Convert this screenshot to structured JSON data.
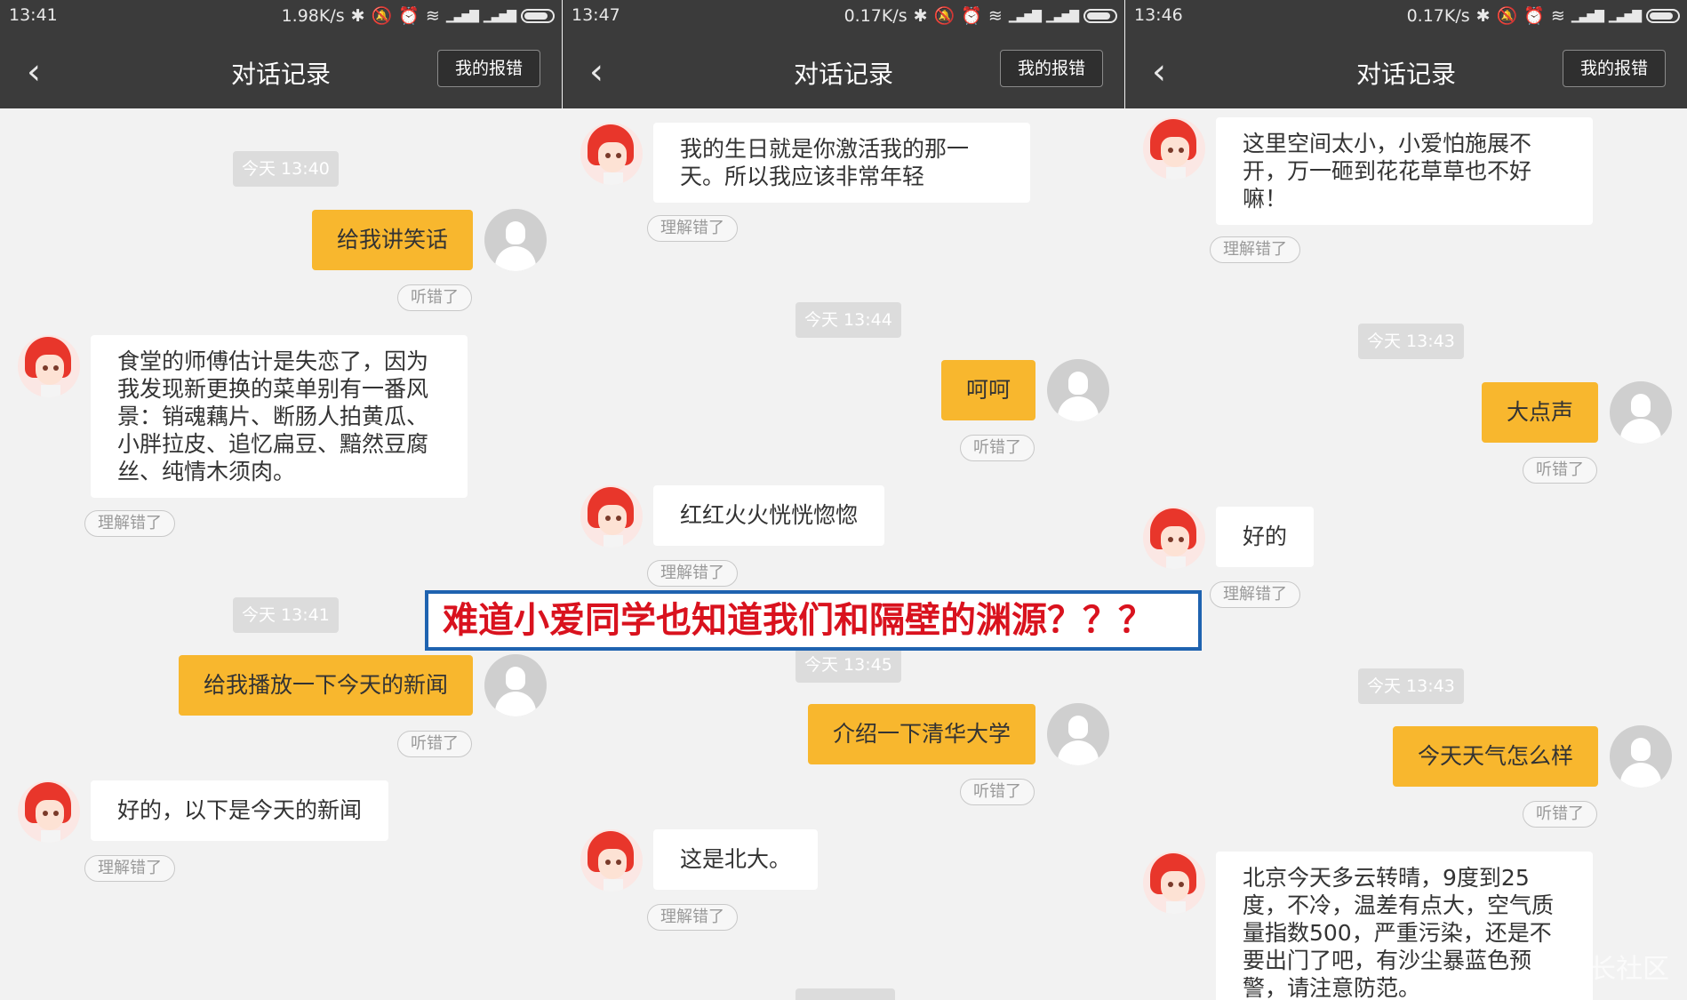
{
  "panels": [
    {
      "status": {
        "time": "13:41",
        "speed": "1.98K/s"
      },
      "header": {
        "title": "对话记录",
        "report": "我的报错"
      },
      "timestamps": [
        "今天 13:40",
        "今天 13:41"
      ],
      "user_msgs": [
        "给我讲笑话",
        "给我播放一下今天的新闻"
      ],
      "bot_msgs": [
        "食堂的师傅估计是失恋了，因为我发现新更换的菜单别有一番风景：销魂藕片、断肠人拍黄瓜、小胖拉皮、追忆扁豆、黯然豆腐丝、纯情木须肉。",
        "好的，以下是今天的新闻"
      ],
      "tag_heard": "听错了",
      "tag_understood": "理解错了"
    },
    {
      "status": {
        "time": "13:47",
        "speed": "0.17K/s"
      },
      "header": {
        "title": "对话记录",
        "report": "我的报错"
      },
      "timestamps": [
        "今天 13:44",
        "今天 13:45"
      ],
      "user_msgs": [
        "呵呵",
        "介绍一下清华大学"
      ],
      "bot_msgs": [
        "我的生日就是你激活我的那一天。所以我应该非常年轻",
        "红红火火恍恍惚惚",
        "这是北大。"
      ],
      "tag_heard": "听错了",
      "tag_understood": "理解错了"
    },
    {
      "status": {
        "time": "13:46",
        "speed": "0.17K/s"
      },
      "header": {
        "title": "对话记录",
        "report": "我的报错"
      },
      "timestamps": [
        "今天 13:43",
        "今天 13:43"
      ],
      "user_msgs": [
        "大点声",
        "今天天气怎么样"
      ],
      "bot_msgs": [
        "这里空间太小，小爱怕施展不开，万一砸到花花草草也不好嘛！",
        "好的",
        "北京今天多云转晴，9度到25度，不冷，温差有点大，空气质量指数500，严重污染，还是不要出门了吧，有沙尘暴蓝色预警，请注意防范。"
      ],
      "tag_heard": "听错了",
      "tag_understood": "理解错了"
    }
  ],
  "overlay_caption": "难道小爱同学也知道我们和隔壁的渊源？？？",
  "watermark": "长社区",
  "colors": {
    "header_bg": "#3b3b3b",
    "user_bubble": "#f8b72e",
    "bot_bubble": "#ffffff",
    "caption_red": "#d9121e",
    "caption_border": "#1f63b0"
  }
}
